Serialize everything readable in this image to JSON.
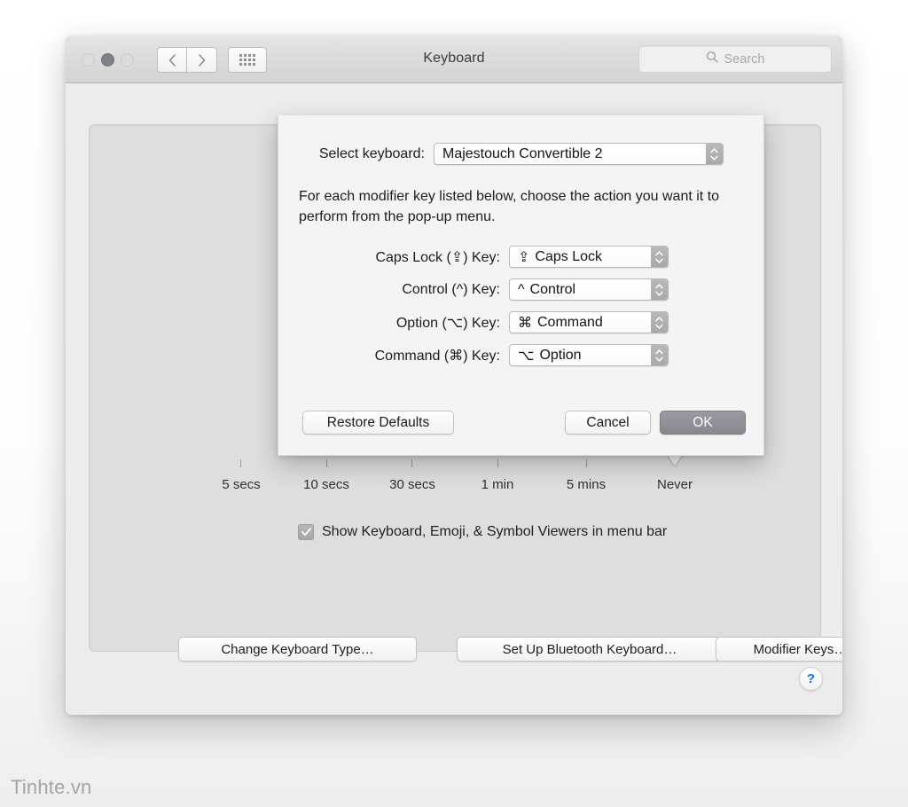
{
  "window": {
    "title": "Keyboard",
    "traffic_lights": [
      "close",
      "minimize",
      "zoom"
    ],
    "search": {
      "placeholder": "Search",
      "value": ""
    }
  },
  "main": {
    "slider": {
      "tick_labels": [
        "5 secs",
        "10 secs",
        "30 secs",
        "1 min",
        "5 mins",
        "Never"
      ],
      "value": "Never"
    },
    "checkbox": {
      "label": "Show Keyboard, Emoji, & Symbol Viewers in menu bar",
      "checked": true
    },
    "buttons": [
      {
        "label": "Change Keyboard Type…"
      },
      {
        "label": "Set Up Bluetooth Keyboard…"
      },
      {
        "label": "Modifier Keys…"
      }
    ],
    "help_label": "?"
  },
  "sheet": {
    "select_keyboard_label": "Select keyboard:",
    "selected_keyboard": "Majestouch Convertible 2",
    "description": "For each modifier key listed below, choose the action you want it to perform from the pop-up menu.",
    "modifiers": [
      {
        "label": "Caps Lock (⇪) Key:",
        "symbol": "⇪",
        "value": "Caps Lock"
      },
      {
        "label": "Control (^) Key:",
        "symbol": "^",
        "value": "Control"
      },
      {
        "label": "Option (⌥) Key:",
        "symbol": "⌘",
        "value": "Command"
      },
      {
        "label": "Command (⌘) Key:",
        "symbol": "⌥",
        "value": "Option"
      }
    ],
    "restore_label": "Restore Defaults",
    "cancel_label": "Cancel",
    "ok_label": "OK"
  },
  "watermark": "Tinhte.vn",
  "colors": {
    "accent_help": "#1a6fe0",
    "window_bg": "#ececec",
    "panel_bg": "#dedede",
    "sheet_bg": "#f4f4f4",
    "default_button_bg": "#8f8f95"
  }
}
